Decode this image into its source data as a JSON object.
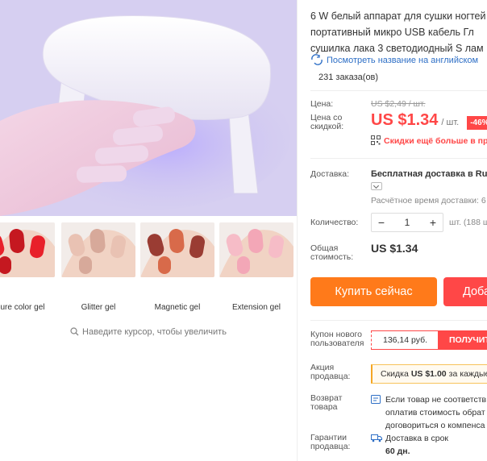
{
  "product": {
    "title_lines": [
      "6 W белый аппарат для сушки ногтей",
      "портативный микро USB кабель Гл",
      "сушилка лака 3 светодиодный S лам"
    ],
    "translate_link": "Посмотреть название на английском",
    "orders": "231 заказа(ов)"
  },
  "gallery": {
    "thumbnails": [
      {
        "caption": "ure color gel",
        "colors": [
          "#e8202a",
          "#c51820"
        ]
      },
      {
        "caption": "Glitter gel",
        "colors": [
          "#e9c2b3",
          "#d7a99a"
        ]
      },
      {
        "caption": "Magnetic gel",
        "colors": [
          "#9a3c33",
          "#d86a4a"
        ]
      },
      {
        "caption": "Extension gel",
        "colors": [
          "#f6bcc7",
          "#f3a7b7"
        ]
      }
    ],
    "zoom_hint": "Наведите курсор, чтобы увеличить"
  },
  "pricing": {
    "price_label": "Цена:",
    "old_price": "US $2,49 / шт.",
    "discount_label": "Цена со скидкой:",
    "price": "US $1.34",
    "per_unit": "/ шт.",
    "discount": "-46%",
    "cheaper_text": "Скидки ещё больше в при"
  },
  "shipping": {
    "label": "Доставка:",
    "value": "Бесплатная доставка в Rus",
    "estimate": "Расчётное время доставки: 6"
  },
  "quantity": {
    "label": "Количество:",
    "minus": "−",
    "value": "1",
    "plus": "+",
    "unit": "шт. (188 ш"
  },
  "total": {
    "label": "Общая стоимость:",
    "value": "US $1.34"
  },
  "actions": {
    "buy_now": "Купить сейчас",
    "add_to_cart": "Доба"
  },
  "coupon": {
    "label": "Купон нового пользователя",
    "amount": "136,14 руб.",
    "get": "ПОЛУЧИТ"
  },
  "seller_promo": {
    "label": "Акция продавца:",
    "text_before": "Скидка",
    "amount": "US $1.00",
    "text_after": "за каждые"
  },
  "returns": {
    "label": "Возврат товара",
    "lines": [
      "Если товар не соответств",
      "оплатив стоимость обрат",
      "договориться о компенса"
    ]
  },
  "guarantee": {
    "label": "Гарантии продавца:",
    "line1": "Доставка в срок",
    "days": "60 дн."
  },
  "colors": {
    "accent_red": "#ff4747",
    "buy_orange": "#ff7a1a",
    "link_blue": "#2e6fc6"
  }
}
